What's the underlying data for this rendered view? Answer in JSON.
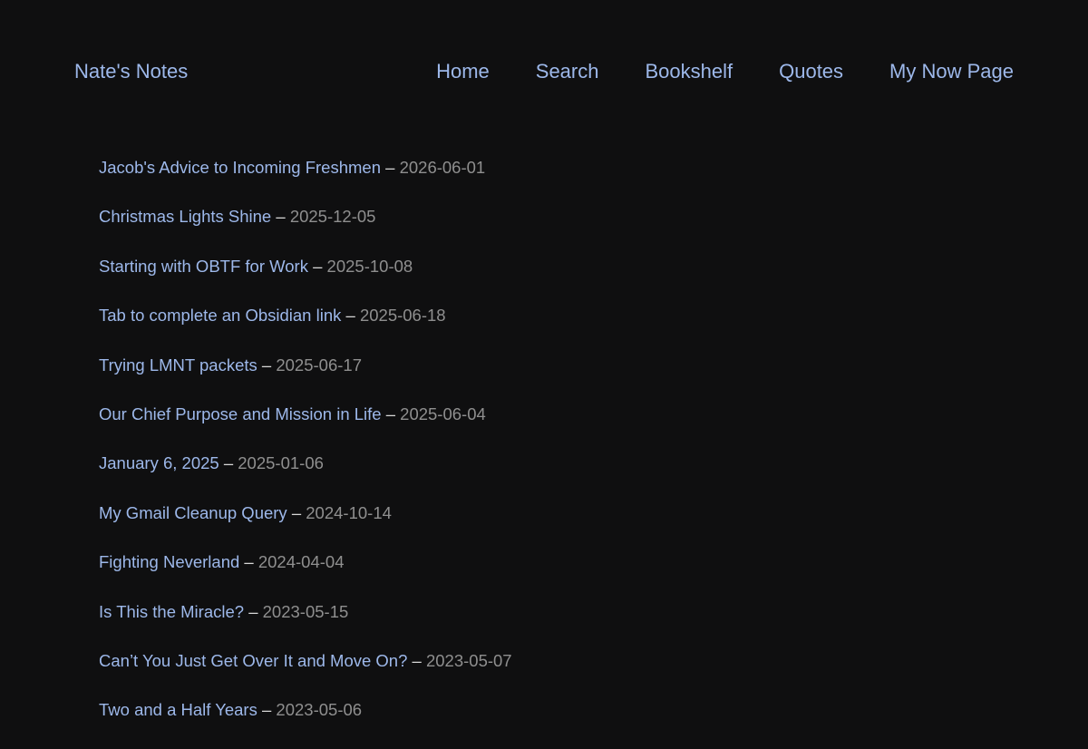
{
  "site": {
    "title": "Nate's Notes"
  },
  "nav": {
    "items": [
      {
        "label": "Home"
      },
      {
        "label": "Search"
      },
      {
        "label": "Bookshelf"
      },
      {
        "label": "Quotes"
      },
      {
        "label": "My Now Page"
      }
    ]
  },
  "posts": [
    {
      "title": "Jacob's Advice to Incoming Freshmen",
      "separator": "–",
      "date": "2026-06-01"
    },
    {
      "title": "Christmas Lights Shine",
      "separator": "–",
      "date": "2025-12-05"
    },
    {
      "title": "Starting with OBTF for Work",
      "separator": "–",
      "date": "2025-10-08"
    },
    {
      "title": "Tab to complete an Obsidian link",
      "separator": "–",
      "date": "2025-06-18"
    },
    {
      "title": "Trying LMNT packets",
      "separator": "–",
      "date": "2025-06-17"
    },
    {
      "title": "Our Chief Purpose and Mission in Life",
      "separator": "–",
      "date": "2025-06-04"
    },
    {
      "title": "January 6, 2025",
      "separator": "–",
      "date": "2025-01-06"
    },
    {
      "title": "My Gmail Cleanup Query",
      "separator": "–",
      "date": "2024-10-14"
    },
    {
      "title": "Fighting Neverland",
      "separator": "–",
      "date": "2024-04-04"
    },
    {
      "title": "Is This the Miracle?",
      "separator": "–",
      "date": "2023-05-15"
    },
    {
      "title": "Can’t You Just Get Over It and Move On?",
      "separator": "–",
      "date": "2023-05-07"
    },
    {
      "title": "Two and a Half Years",
      "separator": "–",
      "date": "2023-05-06"
    }
  ],
  "colors": {
    "background": "#0f0f10",
    "link": "#9db8ea",
    "date": "#8f8f8f",
    "separator": "#d8d8d8"
  }
}
